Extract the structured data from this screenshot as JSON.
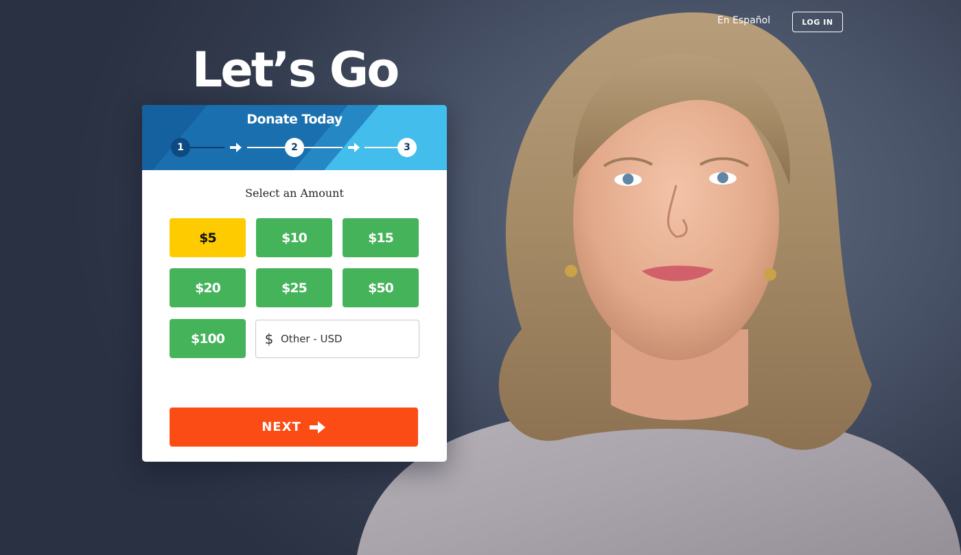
{
  "nav": {
    "language_link": "En Español",
    "login_label": "LOG IN"
  },
  "hero": {
    "headline": "Let’s Go",
    "portrait_alt": "Smiling woman with shoulder-length blonde hair wearing a tweed jacket"
  },
  "donate_card": {
    "title": "Donate Today",
    "steps": [
      {
        "number": "1",
        "state": "current"
      },
      {
        "number": "2",
        "state": "pending"
      },
      {
        "number": "3",
        "state": "pending"
      }
    ],
    "amount_prompt": "Select an Amount",
    "amounts": [
      {
        "label": "$5",
        "selected": true
      },
      {
        "label": "$10",
        "selected": false
      },
      {
        "label": "$15",
        "selected": false
      },
      {
        "label": "$20",
        "selected": false
      },
      {
        "label": "$25",
        "selected": false
      },
      {
        "label": "$50",
        "selected": false
      },
      {
        "label": "$100",
        "selected": false
      }
    ],
    "other_amount": {
      "currency_symbol": "$",
      "placeholder": "Other - USD",
      "value": ""
    },
    "next_label": "NEXT"
  },
  "colors": {
    "selected_amount": "#fecb00",
    "amount_button": "#45b35a",
    "next_button": "#fc4c15",
    "header_dark": "#15609e",
    "header_light": "#43bdec"
  }
}
